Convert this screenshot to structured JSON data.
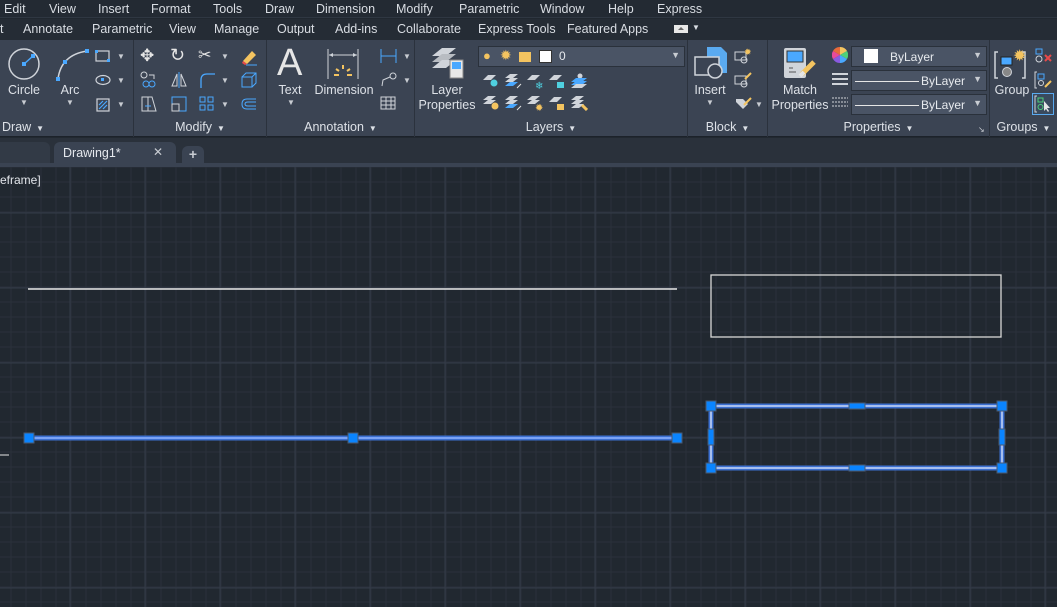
{
  "menu": [
    "Edit",
    "View",
    "Insert",
    "Format",
    "Tools",
    "Draw",
    "Dimension",
    "Modify",
    "Parametric",
    "Window",
    "Help",
    "Express"
  ],
  "menu_partial_left": "",
  "ribbon_tabs": [
    "t",
    "Annotate",
    "Parametric",
    "View",
    "Manage",
    "Output",
    "Add-ins",
    "Collaborate",
    "Express Tools",
    "Featured Apps"
  ],
  "panels": {
    "draw": {
      "title": "Draw",
      "circle": "Circle",
      "arc": "Arc"
    },
    "modify": {
      "title": "Modify"
    },
    "annotation": {
      "title": "Annotation",
      "text": "Text",
      "dimension": "Dimension"
    },
    "layers": {
      "title": "Layers",
      "layer_properties_1": "Layer",
      "layer_properties_2": "Properties",
      "current_layer": "0"
    },
    "block": {
      "title": "Block",
      "insert": "Insert"
    },
    "properties": {
      "title": "Properties",
      "match_1": "Match",
      "match_2": "Properties",
      "color": "ByLayer",
      "linetype": "ByLayer",
      "lineweight": "ByLayer"
    },
    "groups": {
      "title": "Groups",
      "group": "Group"
    }
  },
  "document_tabs": [
    {
      "label": "Drawing1*",
      "close": "✕"
    }
  ],
  "new_tab": "+",
  "viewport_label": "eframe]",
  "colors": {
    "accent": "#1a8cff",
    "grip": "#0a84ff",
    "selection": "#8fb4ff",
    "line": "#e6e6e6",
    "grid_major": "#343c48",
    "grid_minor": "#2a313b"
  }
}
